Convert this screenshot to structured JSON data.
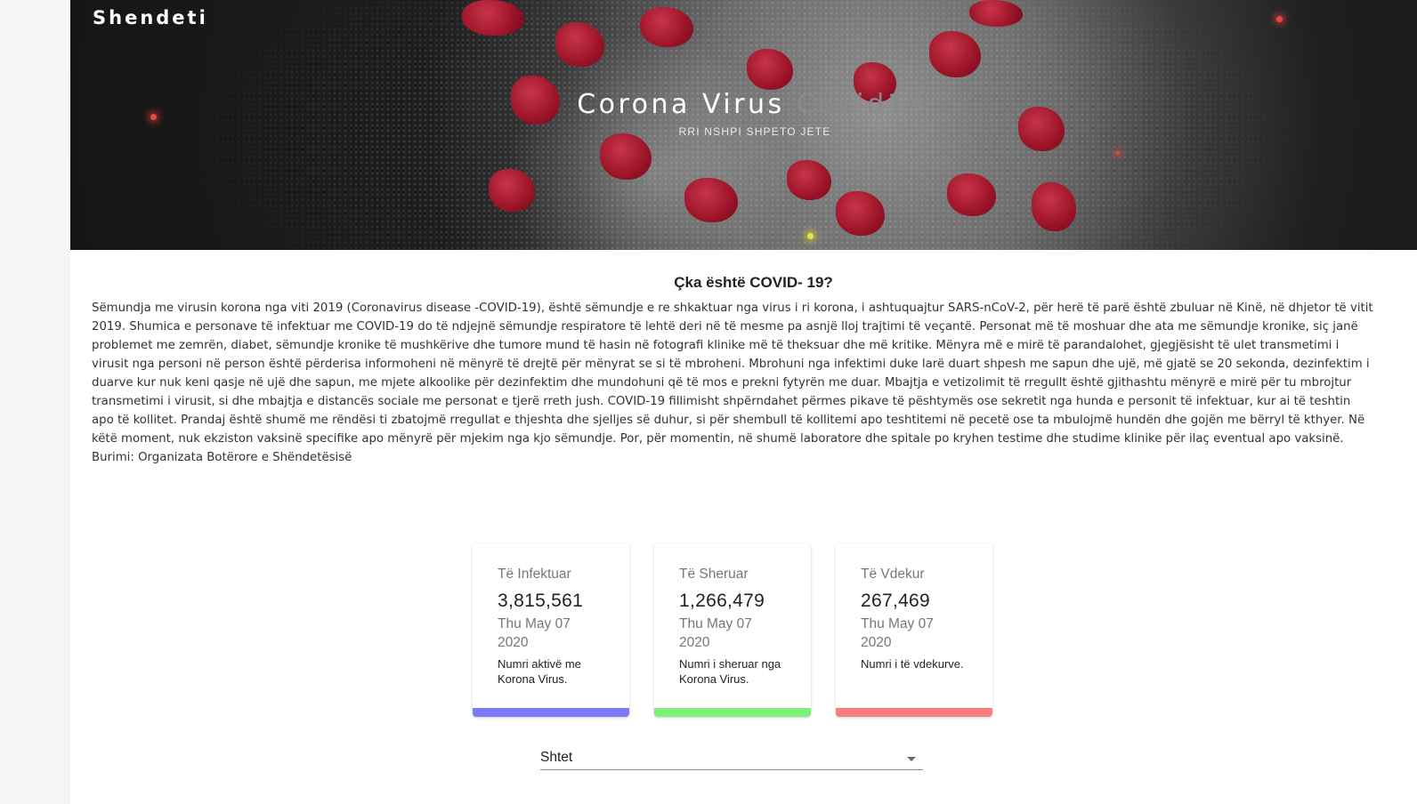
{
  "header": {
    "brand": "Shendeti",
    "title_main": "Corona Virus",
    "title_dim": "Covid19",
    "subtitle": "RRI NSHPI SHPETO JETE"
  },
  "section": {
    "title": "Çka është COVID- 19?",
    "text": "Sëmundja me virusin korona nga viti 2019 (Coronavirus disease -COVID-19), është sëmundje e re shkaktuar nga virus i ri korona, i ashtuquajtur SARS-nCoV-2, për herë të parë është zbuluar në Kinë, në dhjetor të vitit 2019. Shumica e personave të infektuar me COVID-19 do të ndjejnë sëmundje respiratore të lehtë deri në të mesme pa asnjë lloj trajtimi të veçantë. Personat më të moshuar dhe ata me sëmundje kronike, siç janë problemet me zemrën, diabet, sëmundje kronike të mushkërive dhe tumore mund të hasin në fotografi klinike më të theksuar dhe më kritike. Mënyra më e mirë të parandalohet, gjegjësisht të ulet transmetimi i virusit nga personi në person është përderisa informoheni në mënyrë të drejtë për mënyrat se si të mbroheni. Mbrohuni nga infektimi duke larë duart shpesh me sapun dhe ujë, më gjatë se 20 sekonda, dezinfektim i duarve kur nuk keni qasje në ujë dhe sapun, me mjete alkoolike për dezinfektim dhe mundohuni që të mos e prekni fytyrën me duar. Mbajtja e vetizolimit të rregullt është gjithashtu mënyrë e mirë për tu mbrojtur transmetimi i virusit, si dhe mbajtja e distancës sociale me personat e tjerë rreth jush. COVID-19 fillimisht shpërndahet përmes pikave të pështymës ose sekretit nga hunda e personit të infektuar, kur ai të teshtin apo të kollitet. Prandaj është shumë me rëndësi ti zbatojmë rregullat e thjeshta dhe sjelljes së duhur, si për shembull të kollitemi apo teshtitemi në pecetë ose ta mbulojmë hundën dhe gojën me bërryl të kthyer. Në këtë moment, nuk ekziston vaksinë specifike apo mënyrë për mjekim nga kjo sëmundje. Por, për momentin, në shumë laboratore dhe spitale po kryhen testime dhe studime klinike për ilaç eventual apo vaksinë. Burimi: Organizata Botërore e Shëndetësisë"
  },
  "cards": [
    {
      "label": "Të Infektuar",
      "value": "3,815,561",
      "date": "Thu May 07 2020",
      "desc": "Numri aktivë me Korona Virus.",
      "color": "#7b7bf5"
    },
    {
      "label": "Të Sheruar",
      "value": "1,266,479",
      "date": "Thu May 07 2020",
      "desc": "Numri i sheruar nga Korona Virus.",
      "color": "#7ef07a"
    },
    {
      "label": "Të Vdekur",
      "value": "267,469",
      "date": "Thu May 07 2020",
      "desc": "Numri i të vdekurve.",
      "color": "#f57f7f"
    }
  ],
  "country_select": {
    "value": "Shtet"
  },
  "colors": {
    "infected": "#7b7bf5",
    "recovered": "#7ef07a",
    "deaths": "#f57f7f"
  }
}
